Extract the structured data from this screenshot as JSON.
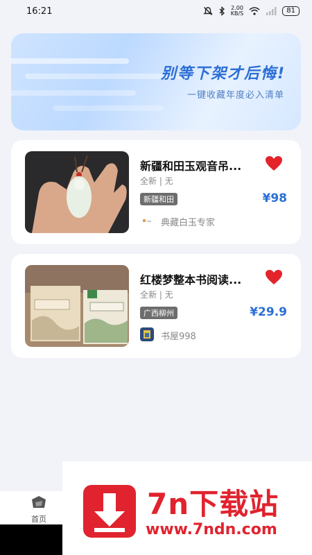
{
  "status_bar": {
    "time": "16:21",
    "net_speed_value": "2.00",
    "net_speed_unit": "KB/S",
    "battery": "81"
  },
  "banner": {
    "title": "别等下架才后悔!",
    "subtitle": "一键收藏年度必入清单"
  },
  "items": [
    {
      "title": "新疆和田玉观音吊...",
      "condition": "全新 | 无",
      "location": "新疆和田",
      "price": "¥98",
      "seller": "典藏白玉专家",
      "favorited": true
    },
    {
      "title": "红楼梦整本书阅读...",
      "condition": "全新 | 无",
      "location": "广西柳州",
      "price": "¥29.9",
      "seller": "书屋998",
      "favorited": true
    }
  ],
  "bottom_nav": {
    "home_label": "首页"
  },
  "watermark": {
    "title": "7n下载站",
    "url": "www.7ndn.com"
  },
  "colors": {
    "accent": "#2a6fd6",
    "heart": "#e5232b",
    "watermark": "#e0232e"
  }
}
